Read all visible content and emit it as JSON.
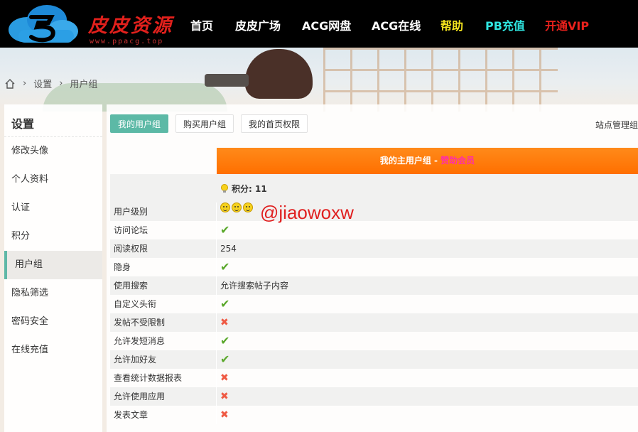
{
  "logo": {
    "title": "皮皮资源",
    "subtitle": "www.ppacg.top"
  },
  "nav": [
    {
      "label": "首页",
      "color": "#ffffff"
    },
    {
      "label": "皮皮广场",
      "color": "#ffffff"
    },
    {
      "label": "ACG网盘",
      "color": "#ffffff"
    },
    {
      "label": "ACG在线",
      "color": "#ffffff"
    },
    {
      "label": "帮助",
      "color": "#f4e41e"
    },
    {
      "label": "PB充值",
      "color": "#2fe6e1"
    },
    {
      "label": "开通VIP",
      "color": "#e8211c"
    }
  ],
  "breadcrumb": {
    "items": [
      "设置",
      "用户组"
    ]
  },
  "sidebar": {
    "title": "设置",
    "items": [
      {
        "label": "修改头像"
      },
      {
        "label": "个人资料"
      },
      {
        "label": "认证"
      },
      {
        "label": "积分"
      },
      {
        "label": "用户组",
        "active": true
      },
      {
        "label": "隐私筛选"
      },
      {
        "label": "密码安全"
      },
      {
        "label": "在线充值"
      }
    ]
  },
  "tabs": [
    {
      "label": "我的用户组",
      "active": true
    },
    {
      "label": "购买用户组"
    },
    {
      "label": "我的首页权限"
    }
  ],
  "site_admin": "站点管理组",
  "group_header": {
    "prefix": "我的主用户组 - ",
    "group": "赞助会员"
  },
  "score": "积分: 11",
  "watermark": "@jiaowoxw",
  "rows": [
    {
      "label": "用户级别",
      "type": "stars"
    },
    {
      "label": "访问论坛",
      "type": "check"
    },
    {
      "label": "阅读权限",
      "type": "text",
      "value": "254"
    },
    {
      "label": "隐身",
      "type": "check"
    },
    {
      "label": "使用搜索",
      "type": "text",
      "value": "允许搜索帖子内容"
    },
    {
      "label": "自定义头衔",
      "type": "check"
    },
    {
      "label": "发帖不受限制",
      "type": "cross"
    },
    {
      "label": "允许发短消息",
      "type": "check"
    },
    {
      "label": "允许加好友",
      "type": "check"
    },
    {
      "label": "查看统计数据报表",
      "type": "cross"
    },
    {
      "label": "允许使用应用",
      "type": "cross"
    },
    {
      "label": "发表文章",
      "type": "cross"
    }
  ],
  "colors": {
    "accent": "#5cb9a6",
    "orange": "#ff7a0a",
    "group": "#ff2ea8",
    "check": "#5aa82b",
    "cross": "#ef5a44"
  }
}
